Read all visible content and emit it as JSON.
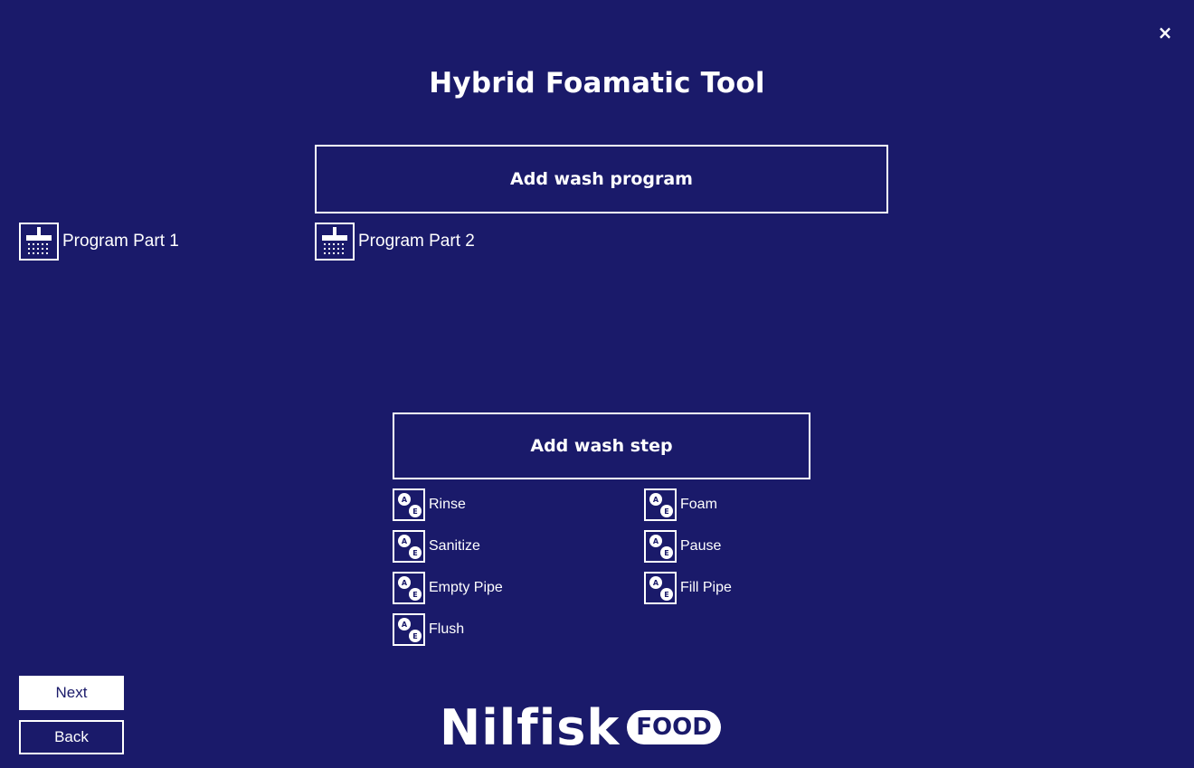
{
  "window": {
    "title": "Hybrid Foamatic Tool",
    "close_icon": "close-icon",
    "close_glyph": "×"
  },
  "programs": {
    "add_button_label": "Add wash program",
    "items": [
      {
        "label": "Program Part 1",
        "icon": "shower-icon"
      },
      {
        "label": "Program Part 2",
        "icon": "shower-icon"
      }
    ]
  },
  "steps": {
    "add_button_label": "Add wash step",
    "items": [
      {
        "label": "Rinse",
        "icon": "wash-step-icon"
      },
      {
        "label": "Foam",
        "icon": "wash-step-icon"
      },
      {
        "label": "Sanitize",
        "icon": "wash-step-icon"
      },
      {
        "label": "Pause",
        "icon": "wash-step-icon"
      },
      {
        "label": "Empty Pipe",
        "icon": "wash-step-icon"
      },
      {
        "label": "Fill Pipe",
        "icon": "wash-step-icon"
      },
      {
        "label": "Flush",
        "icon": "wash-step-icon"
      }
    ]
  },
  "navigation": {
    "next_label": "Next",
    "back_label": "Back"
  },
  "branding": {
    "logo_word": "Nilfisk",
    "logo_badge": "FOOD"
  },
  "colors": {
    "background": "#1a1a6a",
    "foreground": "#ffffff"
  }
}
